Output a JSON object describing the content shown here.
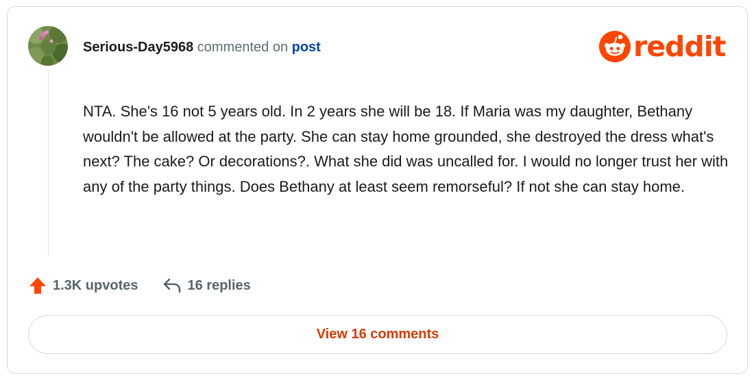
{
  "comment": {
    "username": "Serious-Day5968",
    "action_text": "commented on",
    "post_link": "post",
    "body": "NTA. She's 16 not 5 years old. In 2 years she will be 18. If Maria was my daughter, Bethany wouldn't be allowed at the party. She can stay home grounded, she destroyed the dress what's next? The cake? Or decorations?. What she did was uncalled for. I would no longer trust her with any of the party things. Does Bethany at least seem remorseful? If not she can stay home.",
    "upvotes": "1.3K upvotes",
    "replies": "16 replies"
  },
  "brand": {
    "wordmark": "reddit",
    "color": "#ff4500"
  },
  "footer": {
    "view_comments_label": "View 16 comments"
  },
  "icons": {
    "upvote": "upvote-arrow-icon",
    "reply": "reply-arrow-icon",
    "logo": "reddit-snoo-icon"
  }
}
